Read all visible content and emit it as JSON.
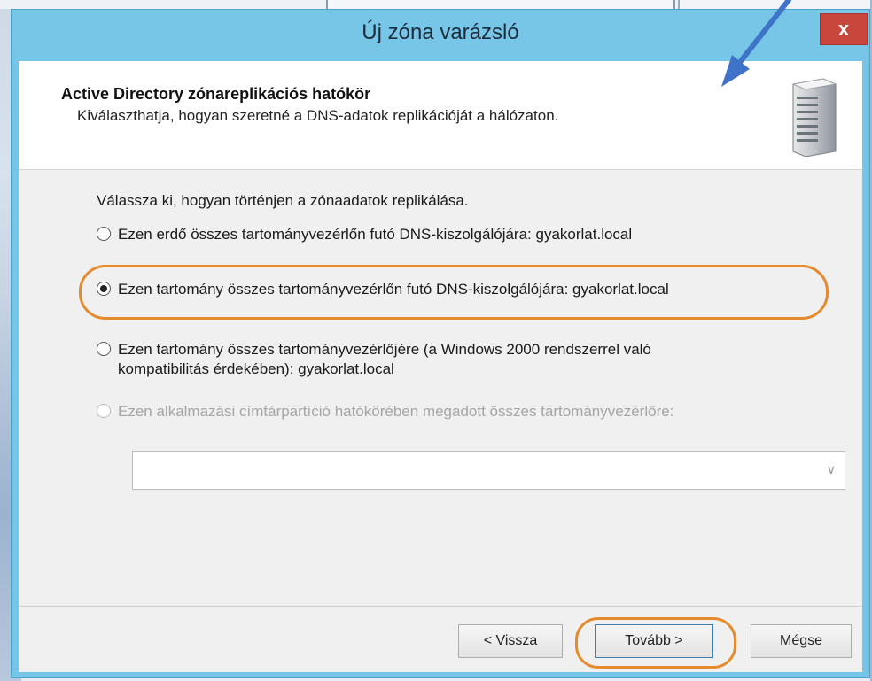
{
  "window": {
    "title": "Új zóna varázsló",
    "close_label": "x"
  },
  "header": {
    "title": "Active Directory zónareplikációs hatókör",
    "subtitle": "Kiválaszthatja, hogyan szeretné a DNS-adatok replikációját a hálózaton."
  },
  "content": {
    "prompt": "Válassza ki, hogyan történjen a zónaadatok replikálása.",
    "options": [
      {
        "label": "Ezen erdő összes tartományvezérlőn futó DNS-kiszolgálójára: gyakorlat.local",
        "checked": false,
        "enabled": true
      },
      {
        "label": "Ezen tartomány összes tartományvezérlőn futó DNS-kiszolgálójára: gyakorlat.local",
        "checked": true,
        "enabled": true
      },
      {
        "label_line1": "Ezen tartomány összes tartományvezérlőjére (a Windows 2000 rendszerrel való",
        "label_line2": "kompatibilitás érdekében): gyakorlat.local",
        "checked": false,
        "enabled": true
      },
      {
        "label": "Ezen alkalmazási címtárpartíció hatókörében megadott összes tartományvezérlőre:",
        "checked": false,
        "enabled": false
      }
    ],
    "partition_select_value": ""
  },
  "buttons": {
    "back": "< Vissza",
    "next": "Tovább >",
    "cancel": "Mégse"
  },
  "colors": {
    "titlebar": "#77c6e8",
    "highlight": "#e68a2e",
    "arrow": "#3f73c9",
    "close": "#c9463d"
  }
}
